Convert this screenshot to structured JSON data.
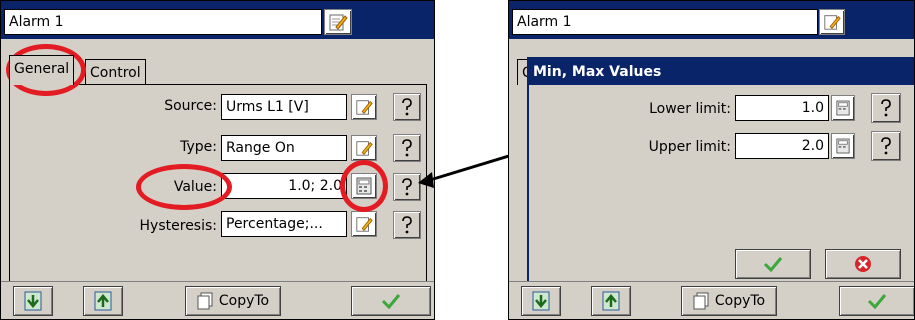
{
  "left_panel": {
    "title": "Alarm 1",
    "tabs": {
      "general": "General",
      "control": "Control"
    },
    "rows": [
      {
        "label": "Source:",
        "value": "Urms L1 [V]"
      },
      {
        "label": "Type:",
        "value": "Range On"
      },
      {
        "label": "Value:",
        "value": "1.0; 2.0"
      },
      {
        "label": "Hysteresis:",
        "value": "Percentage;..."
      }
    ],
    "footer": {
      "copyto": "CopyTo"
    }
  },
  "right_panel": {
    "title": "Alarm 1",
    "tab_fragment": "C",
    "dialog": {
      "title": "Min, Max Values",
      "lower_label": "Lower limit:",
      "lower_value": "1.0",
      "upper_label": "Upper limit:",
      "upper_value": "2.0"
    },
    "footer": {
      "copyto": "CopyTo"
    }
  },
  "colors": {
    "titlebar": "#0a246a",
    "panel": "#d4d0c8",
    "highlight": "#e31b23",
    "ok_check": "#3aa83a",
    "cancel": "#d7262b"
  },
  "icons": [
    "edit-icon",
    "help-icon",
    "calculator-icon",
    "down-arrow-icon",
    "up-arrow-icon",
    "copy-icon",
    "check-icon",
    "cancel-icon"
  ]
}
